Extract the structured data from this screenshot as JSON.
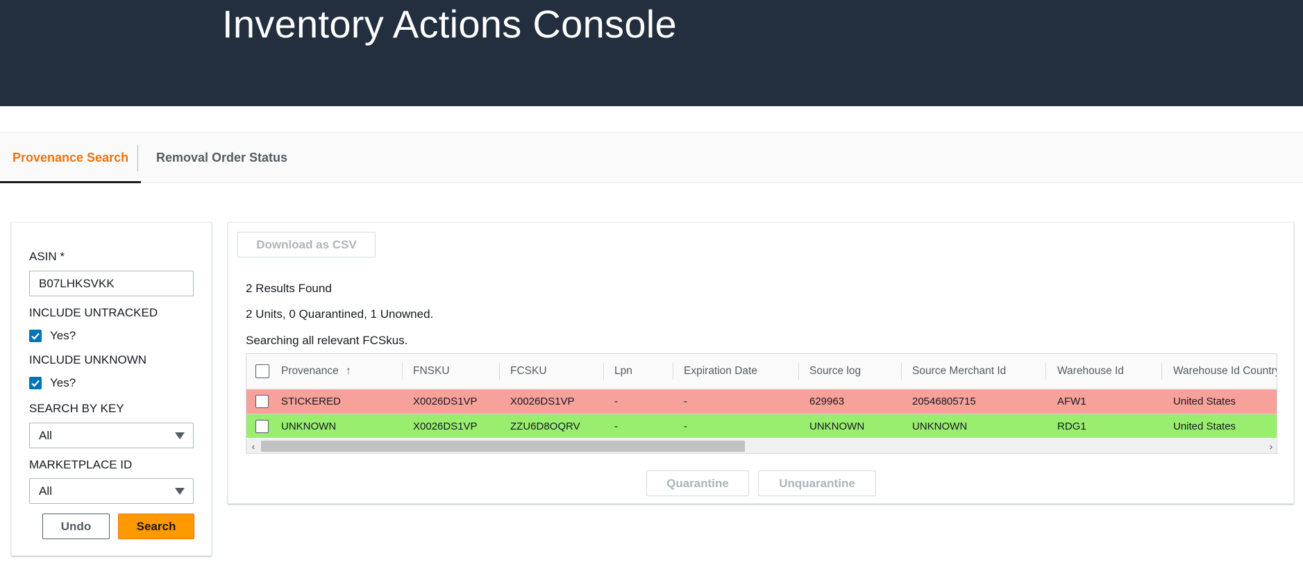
{
  "header": {
    "title": "Inventory Actions Console"
  },
  "tabs": [
    {
      "label": "Provenance Search",
      "active": true
    },
    {
      "label": "Removal Order Status",
      "active": false
    }
  ],
  "filters": {
    "asin_label": "ASIN *",
    "asin_value": "B07LHKSVKK",
    "include_untracked_label": "INCLUDE UNTRACKED",
    "include_untracked_option": "Yes?",
    "include_untracked_checked": true,
    "include_unknown_label": "INCLUDE UNKNOWN",
    "include_unknown_option": "Yes?",
    "include_unknown_checked": true,
    "search_by_key_label": "SEARCH BY KEY",
    "search_by_key_value": "All",
    "marketplace_id_label": "MARKETPLACE ID",
    "marketplace_id_value": "All",
    "undo_label": "Undo",
    "search_label": "Search"
  },
  "results": {
    "download_label": "Download as CSV",
    "count_text": "2 Results Found",
    "summary_text": "2 Units, 0 Quarantined, 1 Unowned.",
    "scope_text": "Searching all relevant FCSkus.",
    "columns": [
      "Provenance",
      "FNSKU",
      "FCSKU",
      "Lpn",
      "Expiration Date",
      "Source log",
      "Source Merchant Id",
      "Warehouse Id",
      "Warehouse Id Country"
    ],
    "sort_indicator": "↑",
    "rows": [
      {
        "provenance": "STICKERED",
        "fnsku": "X0026DS1VP",
        "fcsku": "X0026DS1VP",
        "lpn": "-",
        "expiration_date": "-",
        "source_log": "629963",
        "source_merchant_id": "20546805715",
        "warehouse_id": "AFW1",
        "warehouse_country": "United States",
        "row_color": "#f6a19a"
      },
      {
        "provenance": "UNKNOWN",
        "fnsku": "X0026DS1VP",
        "fcsku": "ZZU6D8OQRV",
        "lpn": "-",
        "expiration_date": "-",
        "source_log": "UNKNOWN",
        "source_merchant_id": "UNKNOWN",
        "warehouse_id": "RDG1",
        "warehouse_country": "United States",
        "row_color": "#99ee70"
      }
    ],
    "quarantine_label": "Quarantine",
    "unquarantine_label": "Unquarantine"
  },
  "colors": {
    "header_bg": "#232f3e",
    "accent_orange": "#ec7211",
    "search_button": "#ff9900",
    "checkbox_blue": "#0073bb"
  },
  "icons": {
    "checkbox_checked": "check-icon",
    "dropdown": "caret-down-icon",
    "sort": "sort-ascending-icon"
  }
}
